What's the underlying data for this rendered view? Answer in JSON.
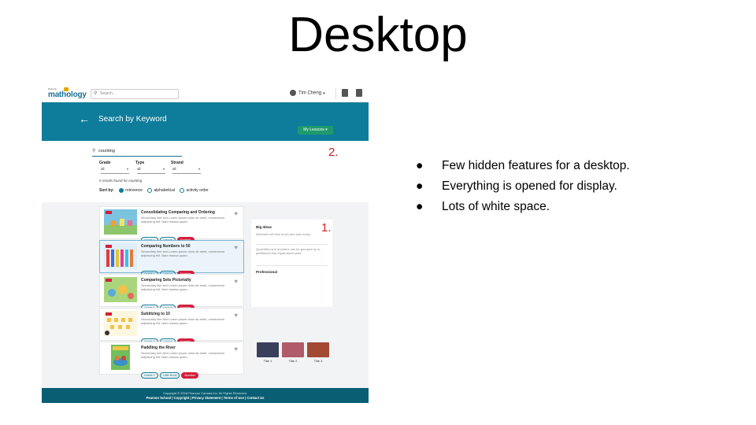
{
  "slide": {
    "title": "Desktop",
    "bullets": [
      "Few hidden features for a desktop.",
      "Everything is opened for display.",
      "Lots of white space."
    ],
    "markers": [
      "1.",
      "2."
    ]
  },
  "app": {
    "logo_small": "Pearson",
    "logo_text": "mathology",
    "search_placeholder": "Search...",
    "user_name": "Tim Cheng",
    "header_title": "Search by Keyword",
    "my_lessons_button": "My Lessons",
    "keyword_value": "counting",
    "filters": [
      {
        "label": "Grade",
        "value": "all"
      },
      {
        "label": "Type",
        "value": "all"
      },
      {
        "label": "Strand",
        "value": "all"
      }
    ],
    "results_count": "5 results found for counting",
    "sort_label": "Sort by:",
    "sort_options": [
      "relevence",
      "alphabetical",
      "activity order"
    ],
    "results": [
      {
        "title": "Consolidating Comparing and Ordering",
        "desc": "Secondary line text Lorem ipsum dolor sit amet, consectetur adipiscing elit. Nam massa quam.",
        "tags": [
          "Grade 1",
          "Lesson",
          "Number"
        ]
      },
      {
        "title": "Comparing Numbers to 50",
        "desc": "Secondary line text Lorem ipsum dolor sit amet, consectetur adipiscing elit. Nam massa quam.",
        "tags": [
          "Grade 1",
          "Lesson",
          "Number"
        ]
      },
      {
        "title": "Comparing Sets Pictorially",
        "desc": "Secondary line text Lorem ipsum dolor sit amet, consectetur adipiscing elit. Nam massa quam.",
        "tags": [
          "Grade 1",
          "Lesson",
          "Number"
        ]
      },
      {
        "title": "Subitizing to 10",
        "desc": "Secondary line text Lorem ipsum dolor sit amet, consectetur adipiscing elit. Nam massa quam.",
        "tags": [
          "Grade 1",
          "Lesson",
          "Number"
        ]
      },
      {
        "title": "Paddling the River",
        "desc": "Secondary line text Lorem ipsum dolor sit amet, consectetur adipiscing elit. Nam massa quam.",
        "tags": [
          "Grade 1",
          "Little Book",
          "Number"
        ]
      }
    ],
    "panel": {
      "big_ideas_heading": "Big Ideas",
      "idea_1": "Numbers tell how much and how many.",
      "idea_2": "Quantities and numbers can be grouped by or partitioned into equal-sized units.",
      "professional_heading": "Professional",
      "videos": [
        "Title 1",
        "Title 2",
        "Title 3"
      ]
    },
    "footer_copyright": "Copyright © 2018 Pearson Canada Inc. All Rights Reserved.",
    "footer_links": "Pearson School | Copyright | Privacy Statement | Terms of Use | Contact Us"
  }
}
